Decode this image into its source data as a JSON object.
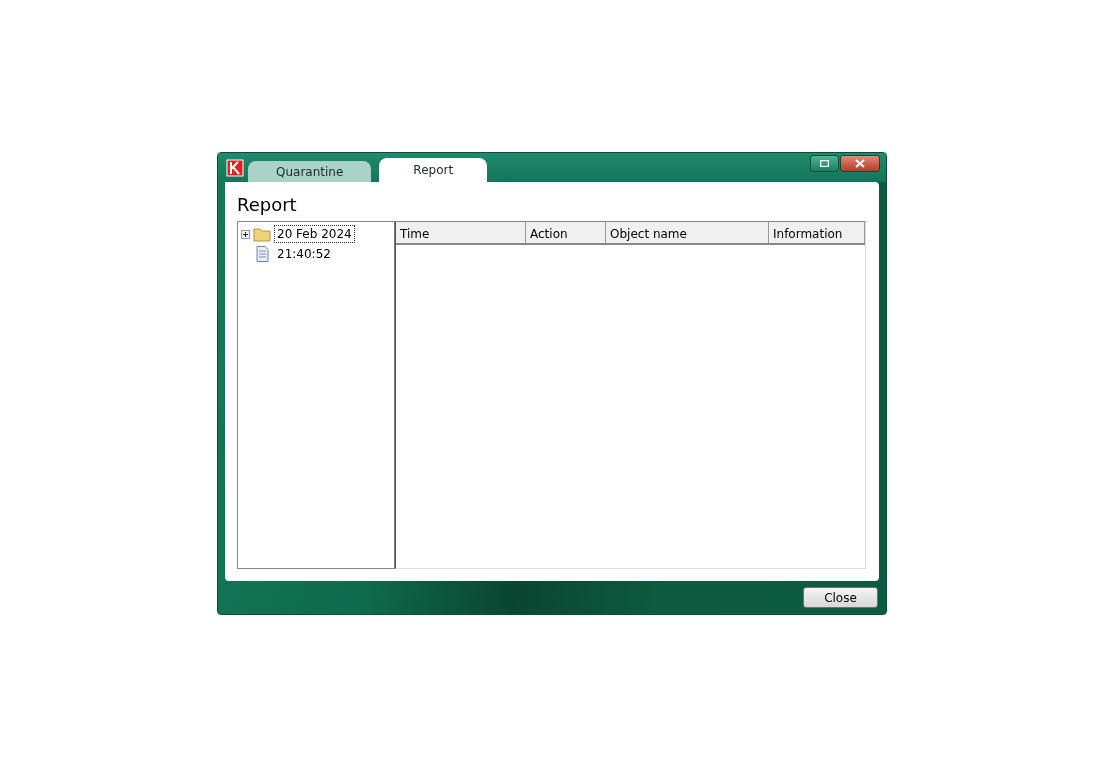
{
  "window": {
    "tabs": [
      {
        "label": "Quarantine",
        "selected": false
      },
      {
        "label": "Report",
        "selected": true
      }
    ]
  },
  "heading": "Report",
  "tree": [
    {
      "label": "20 Feb 2024",
      "kind": "folder",
      "expanded": false,
      "selected": true
    },
    {
      "label": "21:40:52",
      "kind": "document",
      "selected": false
    }
  ],
  "table": {
    "columns": [
      "Time",
      "Action",
      "Object name",
      "Information"
    ]
  },
  "buttons": [
    "Close"
  ]
}
